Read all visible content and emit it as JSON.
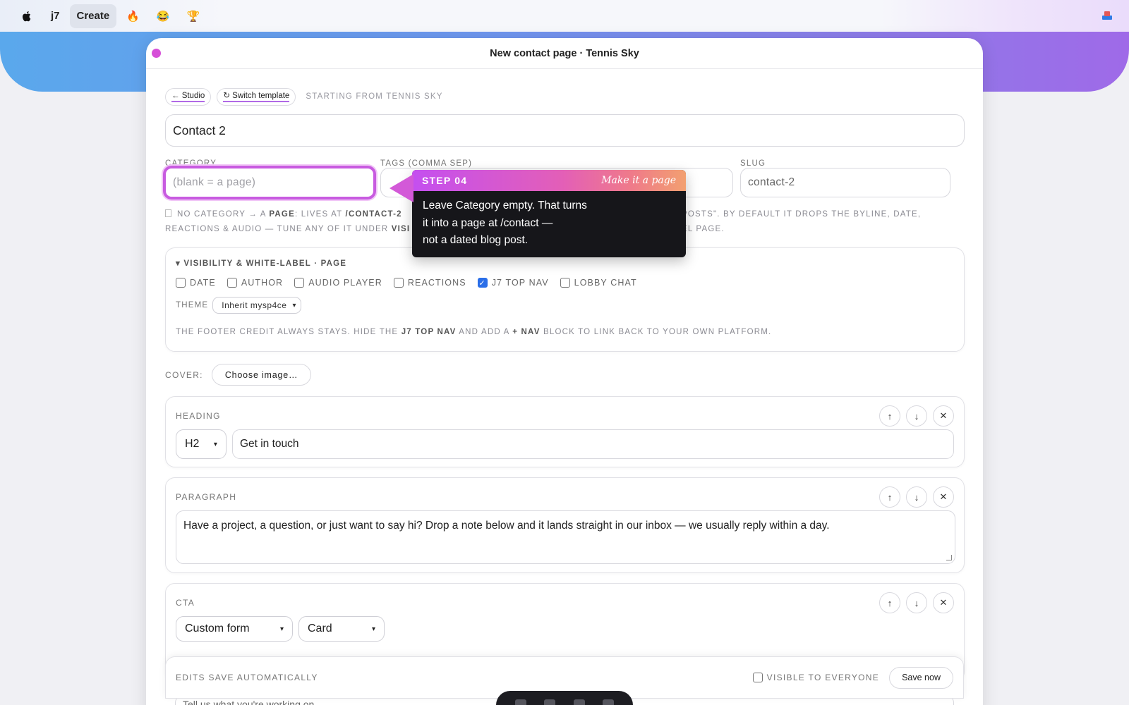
{
  "menubar": {
    "brand": "j7",
    "create": "Create",
    "emojis": [
      "🔥",
      "😂",
      "🏆"
    ]
  },
  "window": {
    "title": "New contact page · Tennis Sky"
  },
  "crumbs": {
    "studio": "← Studio",
    "switch": "↻ Switch template",
    "note": "STARTING FROM TENNIS SKY"
  },
  "title_input": {
    "value": "Contact 2"
  },
  "fields": {
    "category_label": "CATEGORY",
    "category_placeholder": "(blank = a page)",
    "tags_label": "TAGS (COMMA SEP)",
    "slug_label": "SLUG",
    "slug_value": "contact-2"
  },
  "hint": {
    "l1a": "NO CATEGORY → A ",
    "l1b": "PAGE",
    "l1c": ": LIVES AT ",
    "l1d": "/CONTACT-2",
    "l1e": "POSTS\". BY DEFAULT IT DROPS THE BYLINE, DATE,",
    "l2a": "REACTIONS & AUDIO — TUNE ANY OF IT UNDER ",
    "l2b": "VISI",
    "l2c": "EL PAGE."
  },
  "visibility": {
    "heading": "VISIBILITY & WHITE-LABEL · PAGE",
    "checks": [
      {
        "label": "DATE",
        "checked": false
      },
      {
        "label": "AUTHOR",
        "checked": false
      },
      {
        "label": "AUDIO PLAYER",
        "checked": false
      },
      {
        "label": "REACTIONS",
        "checked": false
      },
      {
        "label": "J7 TOP NAV",
        "checked": true
      },
      {
        "label": "LOBBY CHAT",
        "checked": false
      }
    ],
    "theme_label": "THEME",
    "theme_value": "Inherit mysp4ce",
    "footer_a": "THE FOOTER CREDIT ALWAYS STAYS. HIDE THE ",
    "footer_b": "J7 TOP NAV",
    "footer_c": " AND ADD A ",
    "footer_d": "+ NAV",
    "footer_e": " BLOCK TO LINK BACK TO YOUR OWN PLATFORM."
  },
  "cover": {
    "label": "COVER:",
    "button": "Choose image…"
  },
  "blocks": {
    "heading": {
      "label": "HEADING",
      "level": "H2",
      "text": "Get in touch"
    },
    "paragraph": {
      "label": "PARAGRAPH",
      "text": "Have a project, a question, or just want to say hi? Drop a note below and it lands straight in our inbox — we usually reply within a day."
    },
    "cta": {
      "label": "CTA",
      "type": "Custom form",
      "style": "Card"
    },
    "controls": {
      "up": "↑",
      "down": "↓",
      "remove": "✕"
    }
  },
  "savebar": {
    "label": "EDITS SAVE AUTOMATICALLY",
    "visible": "VISIBLE TO EVERYONE",
    "save": "Save now"
  },
  "peek": {
    "text": "Tell us what you're working on"
  },
  "tooltip": {
    "step": "STEP 04",
    "tag": "Make it a page",
    "line1": "Leave Category empty. That turns",
    "line2": "it into a page at /contact —",
    "line3": "not a dated blog post."
  }
}
